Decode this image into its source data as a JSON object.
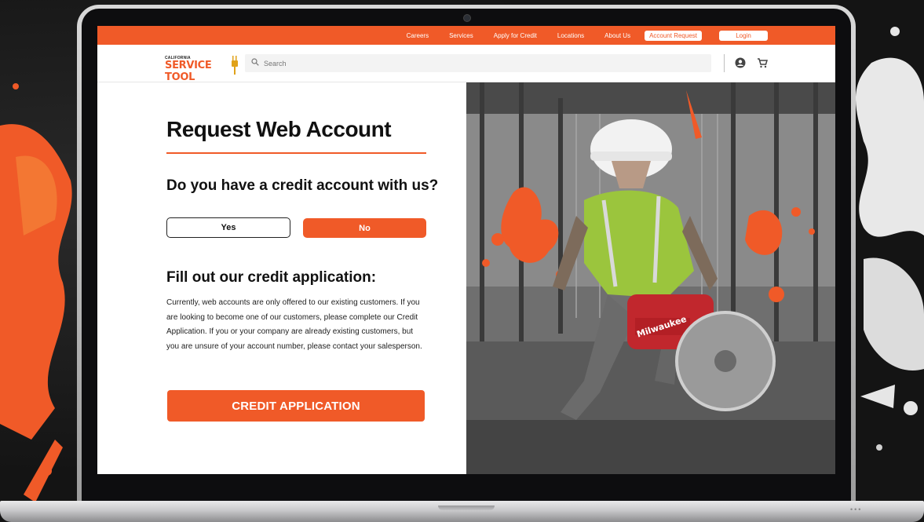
{
  "nav": {
    "links": [
      "Careers",
      "Services",
      "Apply for Credit",
      "Locations",
      "About Us"
    ],
    "account_request": "Account Request",
    "login": "Login"
  },
  "header": {
    "logo_small": "CALIFORNIA",
    "logo_big": "SERVICE TOOL",
    "search_placeholder": "Search",
    "icons": [
      "account-circle-icon",
      "cart-icon"
    ]
  },
  "main": {
    "title": "Request Web Account",
    "question": "Do you have a credit account with us?",
    "yes_label": "Yes",
    "no_label": "No",
    "subhead": "Fill out our credit application:",
    "body": "Currently, web accounts are only offered to our existing customers. If you are looking to become one of our customers, please complete our Credit Application. If you or your company are already existing customers, but you are unsure of your account number, please contact your salesperson.",
    "cta_label": "CREDIT APPLICATION"
  },
  "hero": {
    "saw_brand": "Milwaukee"
  },
  "colors": {
    "accent": "#f05a28",
    "text": "#111111"
  }
}
